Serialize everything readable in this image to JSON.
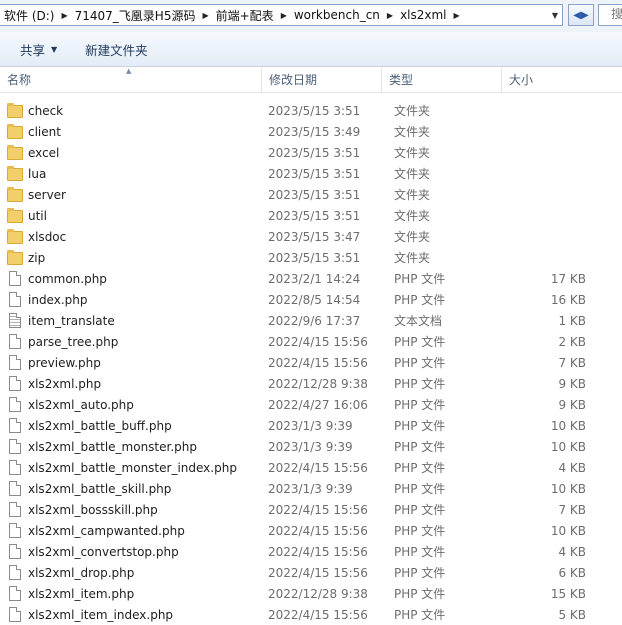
{
  "address": {
    "breadcrumbs": [
      "软件 (D:)",
      "71407_飞凰录H5源码",
      "前端+配表",
      "workbench_cn",
      "xls2xml"
    ],
    "search_placeholder": "搜"
  },
  "toolbar": {
    "share_label": "共享",
    "new_folder_label": "新建文件夹"
  },
  "columns": {
    "name": "名称",
    "date": "修改日期",
    "type": "类型",
    "size": "大小"
  },
  "files": [
    {
      "name": "check",
      "date": "2023/5/15 3:51",
      "type": "文件夹",
      "size": "",
      "kind": "folder"
    },
    {
      "name": "client",
      "date": "2023/5/15 3:49",
      "type": "文件夹",
      "size": "",
      "kind": "folder"
    },
    {
      "name": "excel",
      "date": "2023/5/15 3:51",
      "type": "文件夹",
      "size": "",
      "kind": "folder"
    },
    {
      "name": "lua",
      "date": "2023/5/15 3:51",
      "type": "文件夹",
      "size": "",
      "kind": "folder"
    },
    {
      "name": "server",
      "date": "2023/5/15 3:51",
      "type": "文件夹",
      "size": "",
      "kind": "folder"
    },
    {
      "name": "util",
      "date": "2023/5/15 3:51",
      "type": "文件夹",
      "size": "",
      "kind": "folder"
    },
    {
      "name": "xlsdoc",
      "date": "2023/5/15 3:47",
      "type": "文件夹",
      "size": "",
      "kind": "folder"
    },
    {
      "name": "zip",
      "date": "2023/5/15 3:51",
      "type": "文件夹",
      "size": "",
      "kind": "folder"
    },
    {
      "name": "common.php",
      "date": "2023/2/1 14:24",
      "type": "PHP 文件",
      "size": "17 KB",
      "kind": "file"
    },
    {
      "name": "index.php",
      "date": "2022/8/5 14:54",
      "type": "PHP 文件",
      "size": "16 KB",
      "kind": "file"
    },
    {
      "name": "item_translate",
      "date": "2022/9/6 17:37",
      "type": "文本文档",
      "size": "1 KB",
      "kind": "text"
    },
    {
      "name": "parse_tree.php",
      "date": "2022/4/15 15:56",
      "type": "PHP 文件",
      "size": "2 KB",
      "kind": "file"
    },
    {
      "name": "preview.php",
      "date": "2022/4/15 15:56",
      "type": "PHP 文件",
      "size": "7 KB",
      "kind": "file"
    },
    {
      "name": "xls2xml.php",
      "date": "2022/12/28 9:38",
      "type": "PHP 文件",
      "size": "9 KB",
      "kind": "file"
    },
    {
      "name": "xls2xml_auto.php",
      "date": "2022/4/27 16:06",
      "type": "PHP 文件",
      "size": "9 KB",
      "kind": "file"
    },
    {
      "name": "xls2xml_battle_buff.php",
      "date": "2023/1/3 9:39",
      "type": "PHP 文件",
      "size": "10 KB",
      "kind": "file"
    },
    {
      "name": "xls2xml_battle_monster.php",
      "date": "2023/1/3 9:39",
      "type": "PHP 文件",
      "size": "10 KB",
      "kind": "file"
    },
    {
      "name": "xls2xml_battle_monster_index.php",
      "date": "2022/4/15 15:56",
      "type": "PHP 文件",
      "size": "4 KB",
      "kind": "file"
    },
    {
      "name": "xls2xml_battle_skill.php",
      "date": "2023/1/3 9:39",
      "type": "PHP 文件",
      "size": "10 KB",
      "kind": "file"
    },
    {
      "name": "xls2xml_bossskill.php",
      "date": "2022/4/15 15:56",
      "type": "PHP 文件",
      "size": "7 KB",
      "kind": "file"
    },
    {
      "name": "xls2xml_campwanted.php",
      "date": "2022/4/15 15:56",
      "type": "PHP 文件",
      "size": "10 KB",
      "kind": "file"
    },
    {
      "name": "xls2xml_convertstop.php",
      "date": "2022/4/15 15:56",
      "type": "PHP 文件",
      "size": "4 KB",
      "kind": "file"
    },
    {
      "name": "xls2xml_drop.php",
      "date": "2022/4/15 15:56",
      "type": "PHP 文件",
      "size": "6 KB",
      "kind": "file"
    },
    {
      "name": "xls2xml_item.php",
      "date": "2022/12/28 9:38",
      "type": "PHP 文件",
      "size": "15 KB",
      "kind": "file"
    },
    {
      "name": "xls2xml_item_index.php",
      "date": "2022/4/15 15:56",
      "type": "PHP 文件",
      "size": "5 KB",
      "kind": "file"
    }
  ]
}
